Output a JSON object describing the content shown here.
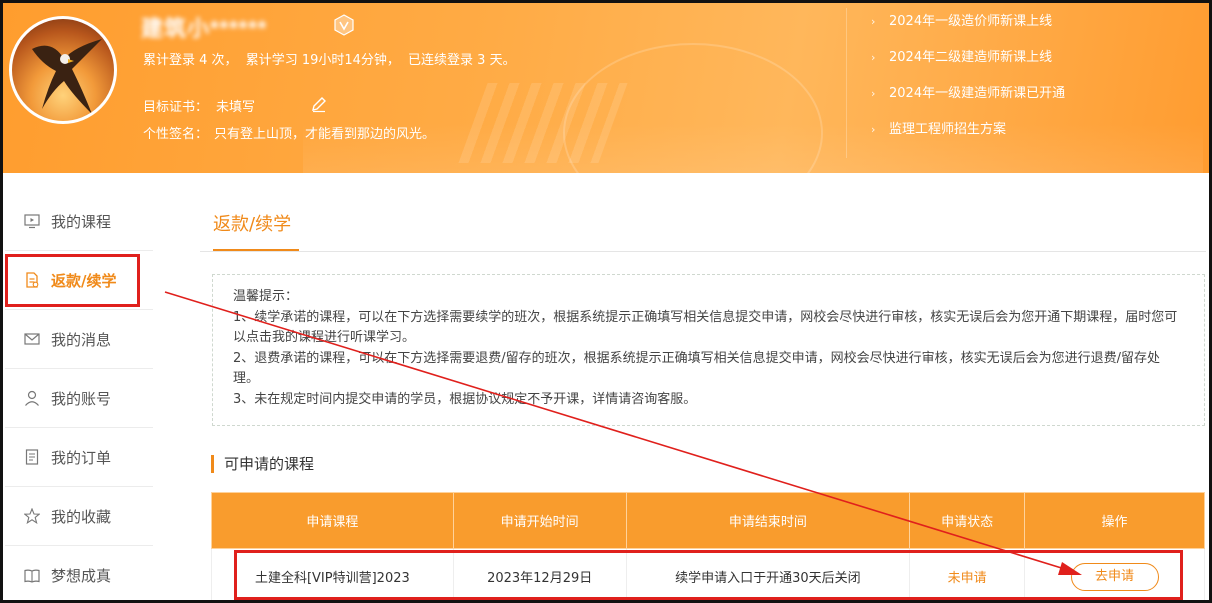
{
  "header": {
    "user_name": "建筑小******",
    "stats": {
      "login": "累计登录 4 次，",
      "study": "累计学习 19小时14分钟，",
      "streak": "已连续登录 3 天。"
    },
    "target_cert_label": "目标证书：",
    "target_cert_value": "未填写",
    "signature_label": "个性签名：",
    "signature_value": "只有登上山顶，才能看到那边的风光。"
  },
  "news": [
    "2024年一级造价师新课上线",
    "2024年二级建造师新课上线",
    "2024年一级建造师新课已开通",
    "监理工程师招生方案"
  ],
  "sidebar": {
    "items": [
      {
        "label": "我的课程",
        "icon": "play-screen-icon"
      },
      {
        "label": "返款/续学",
        "icon": "document-icon",
        "active": true
      },
      {
        "label": "我的消息",
        "icon": "mail-icon"
      },
      {
        "label": "我的账号",
        "icon": "user-icon"
      },
      {
        "label": "我的订单",
        "icon": "order-icon"
      },
      {
        "label": "我的收藏",
        "icon": "star-icon"
      },
      {
        "label": "梦想成真",
        "icon": "book-icon"
      }
    ]
  },
  "main": {
    "tab_label": "返款/续学",
    "notice": {
      "title": "温馨提示：",
      "line1": "1、续学承诺的课程，可以在下方选择需要续学的班次，根据系统提示正确填写相关信息提交申请，网校会尽快进行审核，核实无误后会为您开通下期课程，届时您可以点击我的课程进行听课学习。",
      "line2": "2、退费承诺的课程，可以在下方选择需要退费/留存的班次，根据系统提示正确填写相关信息提交申请，网校会尽快进行审核，核实无误后会为您进行退费/留存处理。",
      "line3": "3、未在规定时间内提交申请的学员，根据协议规定不予开课，详情请咨询客服。"
    },
    "section_title": "可申请的课程",
    "table": {
      "headers": [
        "申请课程",
        "申请开始时间",
        "申请结束时间",
        "申请状态",
        "操作"
      ],
      "rows": [
        {
          "course": "土建全科[VIP特训营]2023",
          "start": "2023年12月29日",
          "end": "续学申请入口于开通30天后关闭",
          "status": "未申请",
          "action": "去申请"
        }
      ]
    }
  },
  "colors": {
    "accent": "#f08a1a",
    "header_bg": "#ffa63d",
    "annotation_red": "#e0201c"
  }
}
